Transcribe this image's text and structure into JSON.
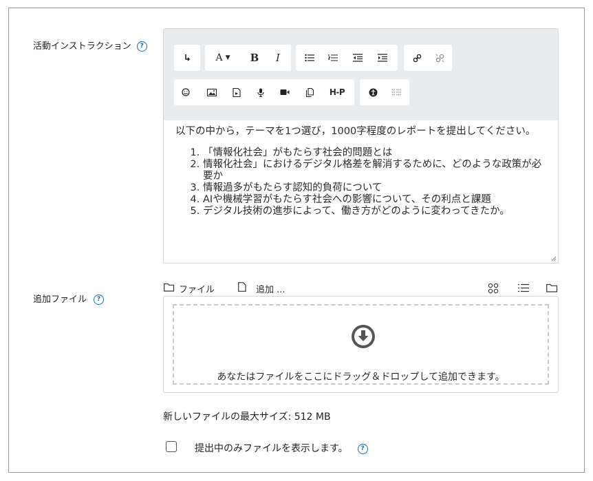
{
  "activity_instructions": {
    "label": "活動インストラクション",
    "help_glyph": "?",
    "toolbar": {
      "row1": [
        "collapse",
        "font-color",
        "bold",
        "italic",
        "unordered-list",
        "ordered-list",
        "outdent",
        "indent",
        "link",
        "unlink"
      ],
      "row2": [
        "emoji",
        "image",
        "media",
        "record-audio",
        "record-video",
        "manage-files",
        "h5p",
        "accessibility-checker",
        "screenreader-helper"
      ],
      "bold_glyph": "B",
      "italic_glyph": "I",
      "font_glyph": "A",
      "h5p_glyph": "H-P"
    },
    "content": {
      "intro": "以下の中から，テーマを1つ選び，1000字程度のレポートを提出してください。",
      "items": [
        "「情報化社会」がもたらす社会的問題とは",
        "情報化社会」におけるデジタル格差を解消するために、どのような政策が必要か",
        "情報過多がもたらす認知的負荷について",
        "AIや機械学習がもたらす社会への影響について、その利点と課題",
        "デジタル技術の進歩によって、働き方がどのように変わってきたか。"
      ]
    }
  },
  "additional_files": {
    "label": "追加ファイル",
    "help_glyph": "?",
    "filepicker": {
      "files_link": "ファイル",
      "add_link": "追加 ..."
    },
    "dropzone_text": "あなたはファイルをここにドラッグ＆ドロップして追加できます。",
    "max_size": "新しいファイルの最大サイズ: 512 MB"
  },
  "only_show_submitted": {
    "label": "提出中のみファイルを表示します。",
    "help_glyph": "?",
    "checked": false
  },
  "colors": {
    "accent": "#0f6cbf",
    "toolbar_bg": "#e9ecef",
    "border": "#d7d7d7"
  }
}
